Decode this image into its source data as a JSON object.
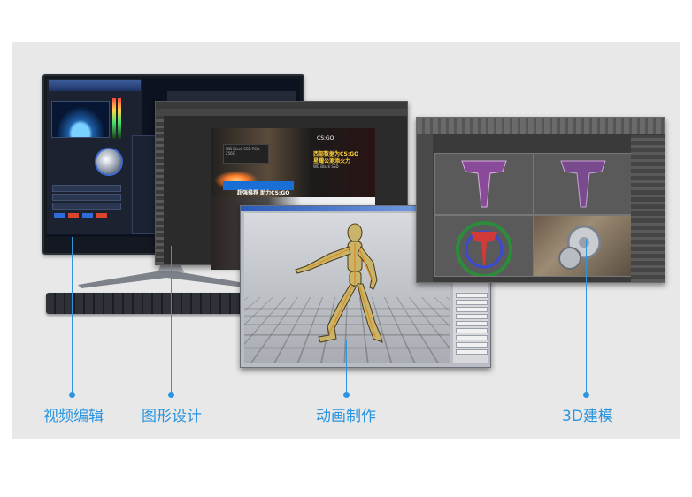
{
  "labels": {
    "video": "视频编辑",
    "design": "图形设计",
    "animation": "动画制作",
    "modeling": "3D建模"
  },
  "photoshop": {
    "logo": "CS:GO",
    "headline1": "西部数据为CS:GO",
    "headline2": "星耀公测添火力",
    "sub": "WD Black SSD",
    "banner": "超强推荐 助力CS:GO",
    "product": "WD Black SSD PCIe 256G"
  },
  "colors": {
    "accent": "#2b95e0",
    "background": "#e8e8e8"
  }
}
